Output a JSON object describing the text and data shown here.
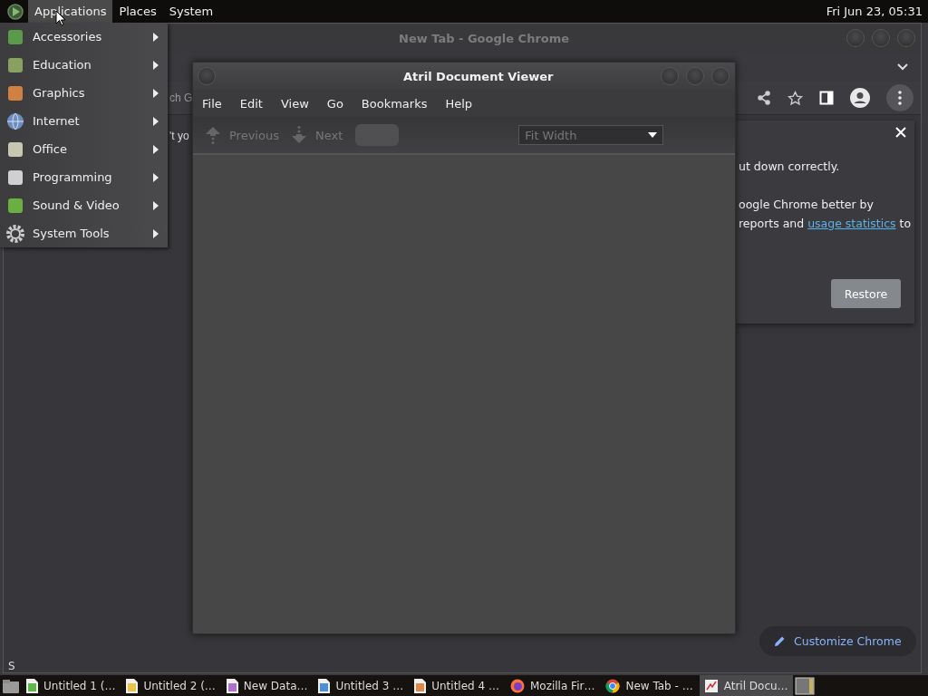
{
  "top_panel": {
    "menus": [
      {
        "label": "Applications",
        "selected": true
      },
      {
        "label": "Places",
        "selected": false
      },
      {
        "label": "System",
        "selected": false
      }
    ],
    "clock": "Fri Jun 23, 05:31"
  },
  "applications_menu": {
    "items": [
      {
        "label": "Accessories"
      },
      {
        "label": "Education"
      },
      {
        "label": "Graphics"
      },
      {
        "label": "Internet"
      },
      {
        "label": "Office"
      },
      {
        "label": "Programming"
      },
      {
        "label": "Sound & Video"
      },
      {
        "label": "System Tools"
      }
    ]
  },
  "chrome_window": {
    "title": "New Tab - Google Chrome",
    "search_fragment": "ch G",
    "text_fragment": "'t yo",
    "edge_fragment": "S",
    "restore_panel": {
      "line_1": "ut down correctly.",
      "line_2": "oogle Chrome better by",
      "line_3_before": "reports and",
      "link": "usage statistics",
      "line_3_after": "to",
      "button": "Restore"
    },
    "customize_button": "Customize Chrome"
  },
  "atril_window": {
    "title": "Atril Document Viewer",
    "menu": [
      "File",
      "Edit",
      "View",
      "Go",
      "Bookmarks",
      "Help"
    ],
    "toolbar": {
      "previous": {
        "label": "Previous",
        "disabled": true
      },
      "next": {
        "label": "Next",
        "disabled": true
      },
      "zoom": "Fit Width"
    }
  },
  "taskbar": {
    "items": [
      {
        "label": "Untitled 1 (…",
        "kind": "spreadsheet",
        "selected": false
      },
      {
        "label": "Untitled 2 (…",
        "kind": "drawing",
        "selected": false
      },
      {
        "label": "New Data…",
        "kind": "database",
        "selected": false
      },
      {
        "label": "Untitled 3 …",
        "kind": "text",
        "selected": false
      },
      {
        "label": "Untitled 4 …",
        "kind": "presentation",
        "selected": false
      },
      {
        "label": "Mozilla Fir…",
        "kind": "firefox",
        "selected": false
      },
      {
        "label": "New Tab - …",
        "kind": "chrome",
        "selected": false
      },
      {
        "label": "Atril Docu…",
        "kind": "viewer",
        "selected": true
      }
    ]
  }
}
